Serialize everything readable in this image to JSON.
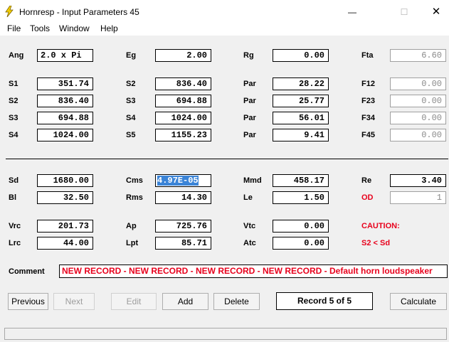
{
  "window": {
    "title": "Hornresp - Input Parameters   45",
    "min": "—",
    "max": "☐",
    "close": "✕"
  },
  "menu": [
    "File",
    "Tools",
    "Window",
    "Help"
  ],
  "params": {
    "ang": {
      "label": "Ang",
      "value": "2.0 x Pi"
    },
    "eg": {
      "label": "Eg",
      "value": "2.00"
    },
    "rg": {
      "label": "Rg",
      "value": "0.00"
    },
    "fta": {
      "label": "Fta",
      "value": "6.60"
    },
    "s1": {
      "label": "S1",
      "value": "351.74"
    },
    "s2": {
      "label": "S2",
      "value": "836.40"
    },
    "s3": {
      "label": "S3",
      "value": "694.88"
    },
    "s4": {
      "label": "S4",
      "value": "1024.00"
    },
    "s2b": {
      "label": "S2",
      "value": "836.40"
    },
    "s3b": {
      "label": "S3",
      "value": "694.88"
    },
    "s4b": {
      "label": "S4",
      "value": "1024.00"
    },
    "s5": {
      "label": "S5",
      "value": "1155.23"
    },
    "par1": {
      "label": "Par",
      "value": "28.22"
    },
    "par2": {
      "label": "Par",
      "value": "25.77"
    },
    "par3": {
      "label": "Par",
      "value": "56.01"
    },
    "par4": {
      "label": "Par",
      "value": "9.41"
    },
    "f12": {
      "label": "F12",
      "value": "0.00"
    },
    "f23": {
      "label": "F23",
      "value": "0.00"
    },
    "f34": {
      "label": "F34",
      "value": "0.00"
    },
    "f45": {
      "label": "F45",
      "value": "0.00"
    },
    "sd": {
      "label": "Sd",
      "value": "1680.00"
    },
    "cms": {
      "label": "Cms",
      "value": "4.97E-05"
    },
    "mmd": {
      "label": "Mmd",
      "value": "458.17"
    },
    "re": {
      "label": "Re",
      "value": "3.40"
    },
    "bl": {
      "label": "Bl",
      "value": "32.50"
    },
    "rms": {
      "label": "Rms",
      "value": "14.30"
    },
    "le": {
      "label": "Le",
      "value": "1.50"
    },
    "od": {
      "label": "OD",
      "value": "1"
    },
    "vrc": {
      "label": "Vrc",
      "value": "201.73"
    },
    "ap": {
      "label": "Ap",
      "value": "725.76"
    },
    "vtc": {
      "label": "Vtc",
      "value": "0.00"
    },
    "lrc": {
      "label": "Lrc",
      "value": "44.00"
    },
    "lpt": {
      "label": "Lpt",
      "value": "85.71"
    },
    "atc": {
      "label": "Atc",
      "value": "0.00"
    }
  },
  "caution": {
    "title": "CAUTION:",
    "message": "S2 < Sd"
  },
  "comment": {
    "label": "Comment",
    "value": "NEW RECORD - NEW RECORD - NEW RECORD - NEW RECORD - Default horn loudspeaker"
  },
  "buttons": {
    "previous": "Previous",
    "next": "Next",
    "edit": "Edit",
    "add": "Add",
    "delete": "Delete",
    "calculate": "Calculate"
  },
  "record": "Record 5 of 5",
  "colors": {
    "accent": "#e8001c",
    "selection": "#3b84d7"
  }
}
